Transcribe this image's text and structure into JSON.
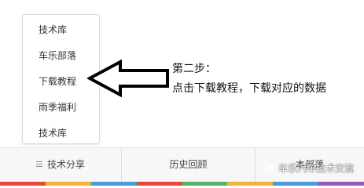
{
  "menu": {
    "items": [
      {
        "label": "技术库"
      },
      {
        "label": "车乐部落"
      },
      {
        "label": "下载教程"
      },
      {
        "label": "雨季福利"
      },
      {
        "label": "技术库"
      }
    ]
  },
  "annotation": {
    "step_title": "第二步：",
    "step_desc": "点击下载教程，下载对应的数据"
  },
  "bottom_nav": {
    "items": [
      {
        "label": "技术分享",
        "icon": "hamburger-icon"
      },
      {
        "label": "历史回顾"
      },
      {
        "label": "本部落"
      }
    ]
  },
  "watermark": {
    "text": "车乐汽车技术交流",
    "icon": "wechat-icon"
  },
  "colors": {
    "strip": [
      "#e8473b",
      "#f3b23a",
      "#4a9ad8",
      "#e8473b",
      "#59b36a",
      "#f3b23a",
      "#4a9ad8",
      "#9b59b6"
    ]
  }
}
